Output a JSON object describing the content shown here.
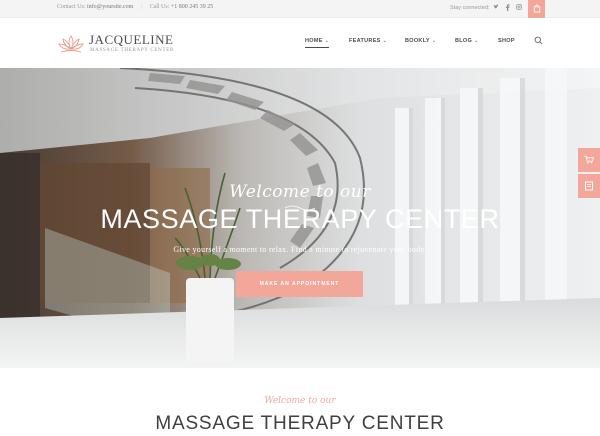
{
  "topbar": {
    "contact_label": "Contact Us:",
    "contact_email": "info@yoursite.com",
    "call_label": "Call Us:",
    "call_number": "+1 800 245 39 25",
    "connected": "Stay connected:",
    "social_icons": [
      "twitter-icon",
      "facebook-icon",
      "instagram-icon"
    ],
    "cart_icon": "shopping-bag-icon"
  },
  "header": {
    "brand": "JACQUELINE",
    "tagline": "MASSAGE THERAPY CENTER",
    "nav": [
      {
        "label": "HOME",
        "chevron": "⌄"
      },
      {
        "label": "FEATURES",
        "chevron": "⌄"
      },
      {
        "label": "BOOKLY",
        "chevron": "⌄"
      },
      {
        "label": "BLOG",
        "chevron": "⌄"
      },
      {
        "label": "SHOP",
        "chevron": ""
      }
    ],
    "search_icon": "search-icon"
  },
  "hero": {
    "script": "Welcome to our",
    "title": "MASSAGE THERAPY CENTER",
    "subtitle": "Give yourself a moment to relax. Find a minute to rejuvenate your body.",
    "cta": "MAKE AN APPOINTMENT",
    "side_buttons": [
      "cart-icon",
      "book-icon"
    ]
  },
  "section": {
    "script": "Welcome to our",
    "title": "MASSAGE THERAPY CENTER"
  },
  "colors": {
    "accent": "#f3a69a",
    "text": "#4a4a4a",
    "topbar_bg": "#f4f4f4"
  }
}
